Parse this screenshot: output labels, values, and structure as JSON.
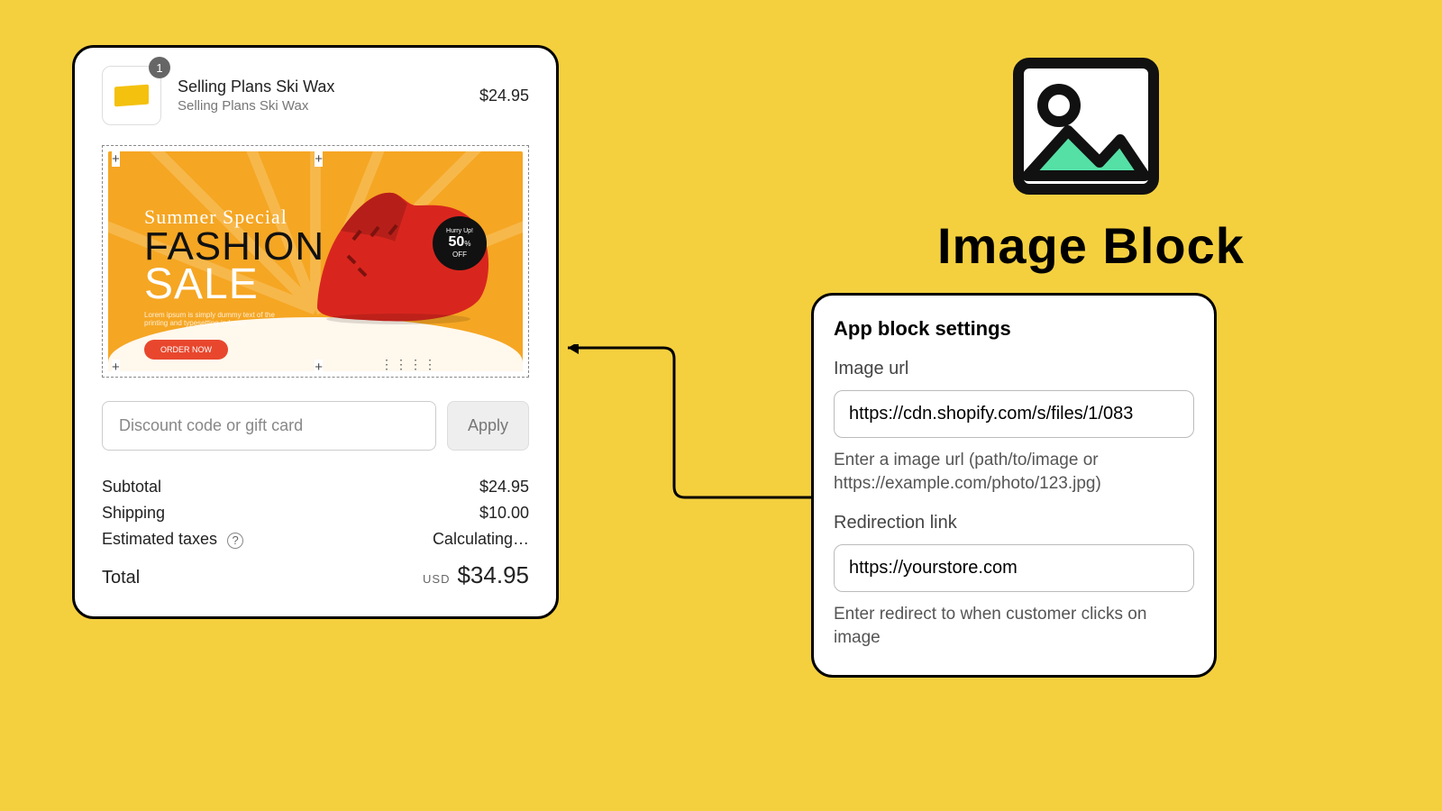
{
  "checkout": {
    "cart": {
      "qty_badge": "1",
      "title": "Selling Plans Ski Wax",
      "subtitle": "Selling Plans Ski Wax",
      "price": "$24.95"
    },
    "promo": {
      "script": "Summer Special",
      "line1": "FASHION",
      "line2": "SALE",
      "button": "ORDER NOW",
      "tag_pct": "50",
      "tag_off": "OFF"
    },
    "discount": {
      "placeholder": "Discount code or gift card",
      "apply": "Apply"
    },
    "totals": {
      "subtotal_label": "Subtotal",
      "subtotal": "$24.95",
      "shipping_label": "Shipping",
      "shipping": "$10.00",
      "taxes_label": "Estimated taxes",
      "taxes": "Calculating…",
      "total_label": "Total",
      "currency": "USD",
      "total": "$34.95"
    }
  },
  "image_block": {
    "title": "Image Block"
  },
  "settings": {
    "heading": "App block settings",
    "image_url_label": "Image url",
    "image_url": "https://cdn.shopify.com/s/files/1/083",
    "image_url_help": "Enter a image url (path/to/image or https://example.com/photo/123.jpg)",
    "redirect_label": "Redirection link",
    "redirect": "https://yourstore.com",
    "redirect_help": "Enter redirect to when customer clicks on image"
  }
}
